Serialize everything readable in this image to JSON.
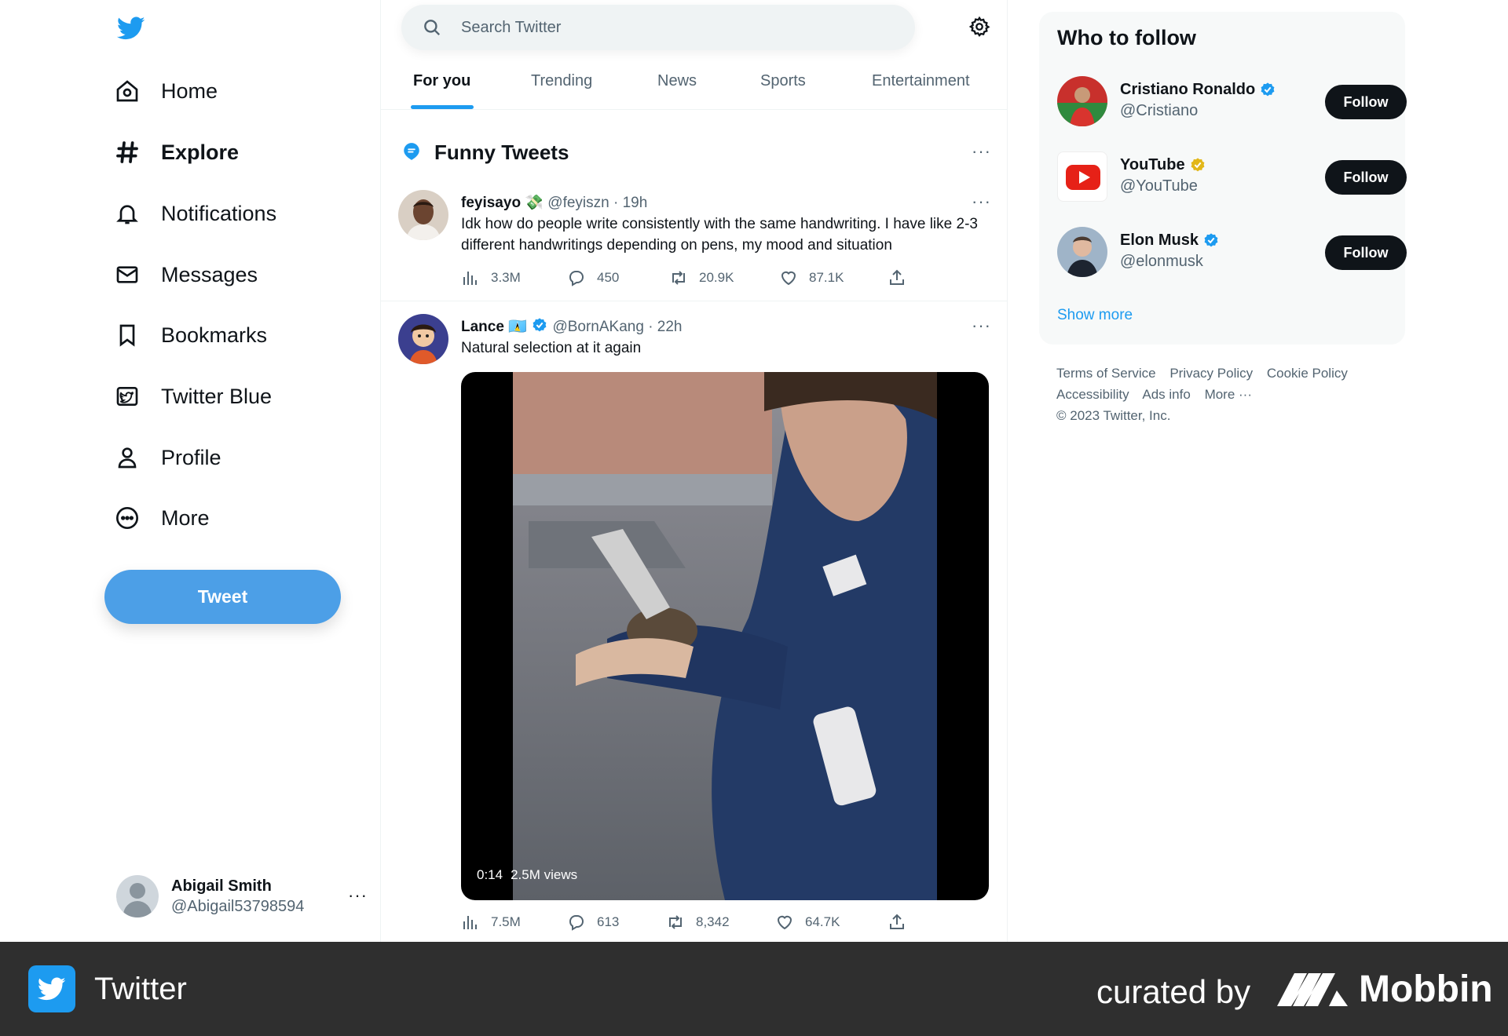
{
  "sidebar": {
    "logo_icon": "twitter-bird-icon",
    "nav": [
      {
        "label": "Home",
        "icon": "home-icon"
      },
      {
        "label": "Explore",
        "icon": "hashtag-icon"
      },
      {
        "label": "Notifications",
        "icon": "bell-icon"
      },
      {
        "label": "Messages",
        "icon": "envelope-icon"
      },
      {
        "label": "Bookmarks",
        "icon": "bookmark-icon"
      },
      {
        "label": "Twitter Blue",
        "icon": "twitter-blue-icon"
      },
      {
        "label": "Profile",
        "icon": "person-icon"
      },
      {
        "label": "More",
        "icon": "more-circle-icon"
      }
    ],
    "tweet_button": "Tweet",
    "account": {
      "name": "Abigail Smith",
      "handle": "@Abigail53798594",
      "more": "···"
    }
  },
  "header": {
    "search_placeholder": "Search Twitter",
    "tabs": [
      "For you",
      "Trending",
      "News",
      "Sports",
      "Entertainment"
    ],
    "active_tab": "For you"
  },
  "section": {
    "title": "Funny Tweets",
    "more": "···"
  },
  "tweets": [
    {
      "author": "feyisayo",
      "emoji": "💸",
      "handle": "@feyiszn",
      "time": "· 19h",
      "text": "Idk how do people write consistently with the same handwriting. I have like 2-3 different handwritings depending on pens, my mood and situation",
      "views": "3.3M",
      "replies": "450",
      "retweets": "20.9K",
      "likes": "87.1K",
      "more": "···"
    },
    {
      "author": "Lance",
      "flag": "🇱🇨",
      "handle": "@BornAKang",
      "time": "· 22h",
      "text": "Natural selection at it again",
      "video_time": "0:14",
      "video_views": "2.5M views",
      "views": "7.5M",
      "replies": "613",
      "retweets": "8,342",
      "likes": "64.7K",
      "more": "···"
    }
  ],
  "who_to_follow": {
    "title": "Who to follow",
    "accounts": [
      {
        "name": "Cristiano Ronaldo",
        "handle": "@Cristiano",
        "badge": "blue",
        "button": "Follow"
      },
      {
        "name": "YouTube",
        "handle": "@YouTube",
        "badge": "gold",
        "button": "Follow"
      },
      {
        "name": "Elon Musk",
        "handle": "@elonmusk",
        "badge": "blue",
        "button": "Follow"
      }
    ],
    "show_more": "Show more"
  },
  "footer": {
    "links": [
      "Terms of Service",
      "Privacy Policy",
      "Cookie Policy",
      "Accessibility",
      "Ads info",
      "More ···"
    ],
    "copyright": "© 2023 Twitter, Inc."
  },
  "bottom_bar": {
    "app_name": "Twitter",
    "curated_by": "curated by",
    "brand": "Mobbin"
  },
  "colors": {
    "accent": "#1d9bf0",
    "tweet_button": "#4c9fe7",
    "text": "#0f1419",
    "secondary_text": "#536471",
    "bottom_bar": "#2f2f2f"
  }
}
